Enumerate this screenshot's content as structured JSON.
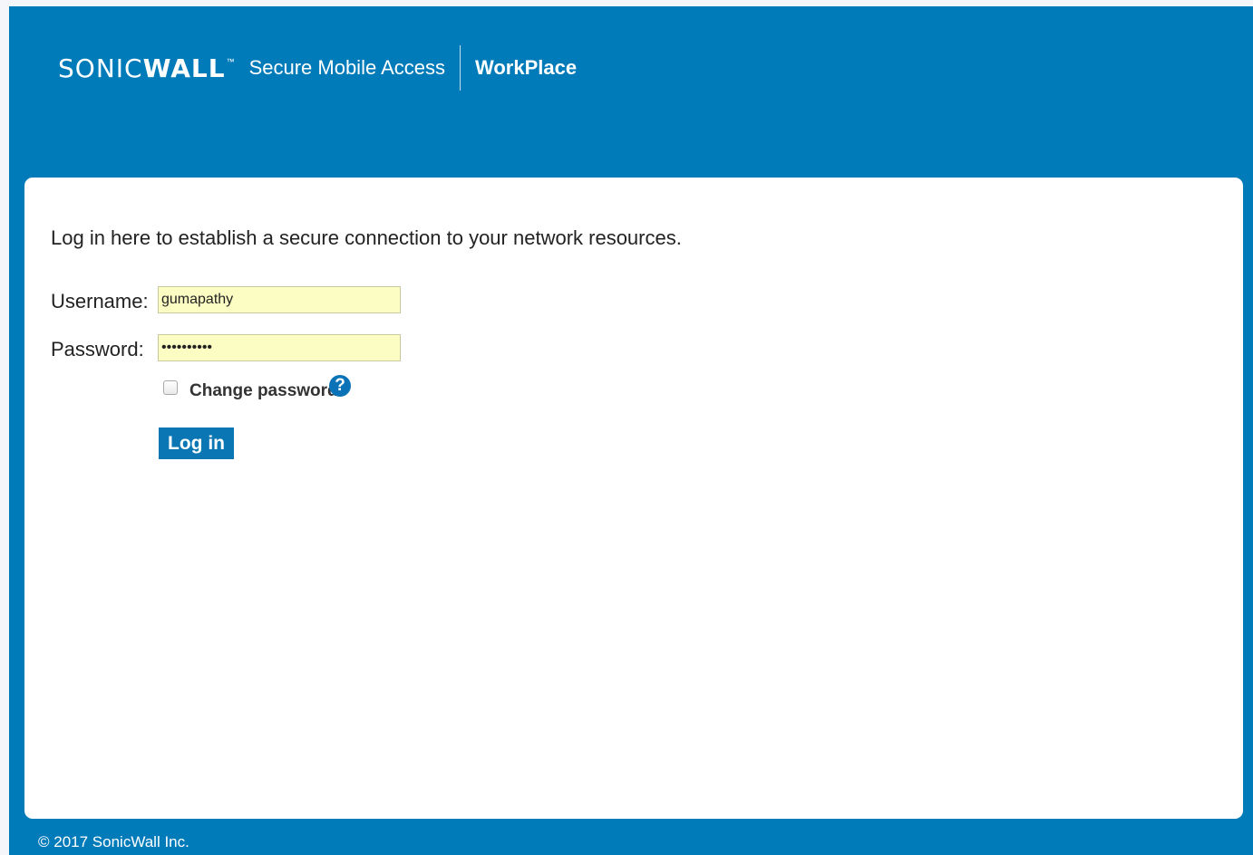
{
  "header": {
    "logo_prefix": "SONIC",
    "logo_bold": "WALL",
    "logo_tm": "™",
    "product": "Secure Mobile Access",
    "portal": "WorkPlace"
  },
  "login": {
    "intro": "Log in here to establish a secure connection to your network resources.",
    "username_label": "Username:",
    "username_value": "gumapathy",
    "password_label": "Password:",
    "password_value": "••••••••••",
    "change_password_label": "Change password",
    "change_password_checked": false,
    "help_glyph": "?",
    "submit_label": "Log in"
  },
  "footer": {
    "copyright": "© 2017 SonicWall Inc."
  },
  "colors": {
    "brand_blue": "#007bba",
    "field_bg": "#fcfdc2",
    "button_blue": "#0b76b4"
  },
  "icons": {
    "help": "question-circle-icon"
  }
}
